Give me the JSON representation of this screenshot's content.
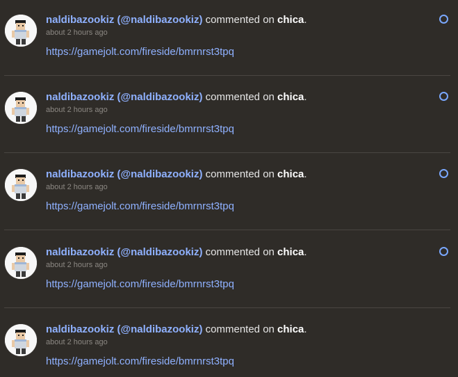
{
  "notifications": [
    {
      "username": "naldibazookiz",
      "handle": "(@naldibazookiz)",
      "action": " commented on ",
      "target": "chica",
      "punct": ".",
      "time": "about 2 hours ago",
      "link": "https://gamejolt.com/fireside/bmrnrst3tpq",
      "unread": true
    },
    {
      "username": "naldibazookiz",
      "handle": "(@naldibazookiz)",
      "action": " commented on ",
      "target": "chica",
      "punct": ".",
      "time": "about 2 hours ago",
      "link": "https://gamejolt.com/fireside/bmrnrst3tpq",
      "unread": true
    },
    {
      "username": "naldibazookiz",
      "handle": "(@naldibazookiz)",
      "action": " commented on ",
      "target": "chica",
      "punct": ".",
      "time": "about 2 hours ago",
      "link": "https://gamejolt.com/fireside/bmrnrst3tpq",
      "unread": true
    },
    {
      "username": "naldibazookiz",
      "handle": "(@naldibazookiz)",
      "action": " commented on ",
      "target": "chica",
      "punct": ".",
      "time": "about 2 hours ago",
      "link": "https://gamejolt.com/fireside/bmrnrst3tpq",
      "unread": true
    },
    {
      "username": "naldibazookiz",
      "handle": "(@naldibazookiz)",
      "action": " commented on ",
      "target": "chica",
      "punct": ".",
      "time": "about 2 hours ago",
      "link": "https://gamejolt.com/fireside/bmrnrst3tpq",
      "unread": false
    }
  ],
  "colors": {
    "background": "#2f2c28",
    "accent": "#8fb1ff",
    "unread_dot": "#7aa8ff",
    "muted": "#8c8883"
  },
  "icons": {
    "avatar": "user-avatar-icon",
    "unread": "unread-dot-icon"
  }
}
